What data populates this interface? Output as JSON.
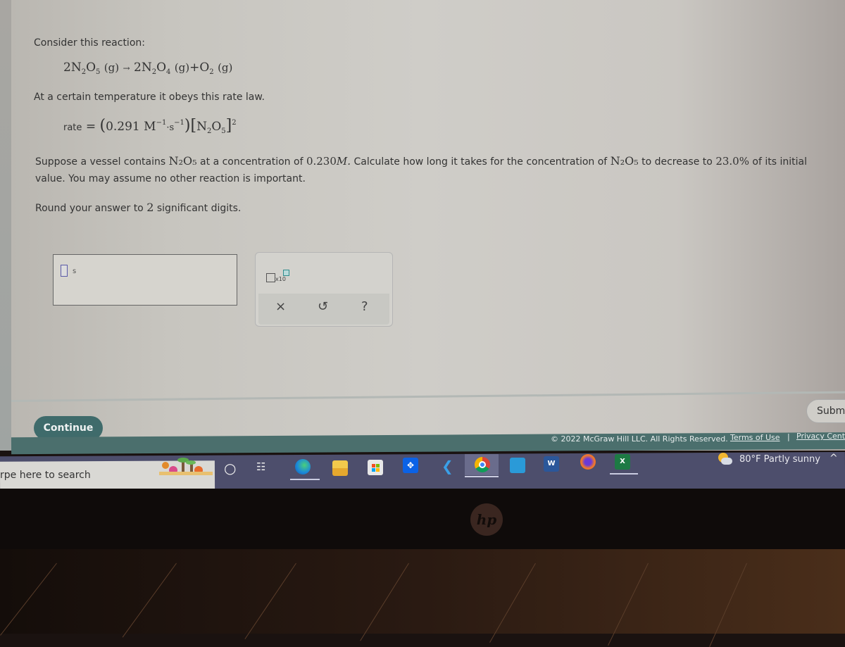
{
  "question": {
    "intro": "Consider this reaction:",
    "reaction": {
      "reactant": {
        "coef": "2",
        "formula": "N",
        "sub1": "2",
        "el2": "O",
        "sub2": "5",
        "state": "(g)"
      },
      "arrow": "→",
      "product1": {
        "coef": "2",
        "formula": "N",
        "sub1": "2",
        "el2": "O",
        "sub2": "4",
        "state": "(g)"
      },
      "plus": "+",
      "product2": {
        "formula": "O",
        "sub1": "2",
        "state": "(g)"
      }
    },
    "rate_law_intro": "At a certain temperature it obeys this rate law.",
    "rate_law": {
      "label": "rate",
      "equals": "=",
      "k_value": "0.291",
      "k_units": "M",
      "k_units_exp1": "−1",
      "k_units_dot": "·s",
      "k_units_exp2": "−1",
      "species": "N",
      "species_sub1": "2",
      "species_el2": "O",
      "species_sub2": "5",
      "order": "2"
    },
    "prompt_part1": "Suppose a vessel contains",
    "prompt_species": "N₂O₅",
    "prompt_part2": "at a concentration of",
    "concentration": "0.230",
    "concentration_unit": "M.",
    "prompt_part3": "Calculate how long it takes for the concentration of",
    "prompt_part4": "to decrease to",
    "percent": "23.0%",
    "prompt_part5": "of its initial",
    "prompt_line2": "value. You may assume no other reaction is important.",
    "round_part1": "Round your answer to",
    "sig_digits": "2",
    "round_part2": "significant digits."
  },
  "answer": {
    "value": "",
    "unit": "s"
  },
  "tools": {
    "sci_notation_label": "x10",
    "clear_symbol": "×",
    "undo_symbol": "↺",
    "help_symbol": "?"
  },
  "actions": {
    "continue_label": "Continue",
    "submit_label": "Subm"
  },
  "footer": {
    "copyright": "© 2022 McGraw Hill LLC. All Rights Reserved.",
    "terms": "Terms of Use",
    "separator": "|",
    "privacy": "Privacy Cente"
  },
  "taskbar": {
    "search_placeholder": "rpe here to search",
    "icons": [
      "search-highlight-icon",
      "cortana-icon",
      "task-view-icon",
      "edge-icon",
      "file-explorer-icon",
      "microsoft-store-icon",
      "dropbox-icon",
      "power-automate-icon",
      "chrome-icon",
      "mail-icon",
      "word-icon",
      "firefox-icon",
      "excel-icon"
    ],
    "weather_temp": "80°F",
    "weather_desc": "Partly sunny",
    "tray_chevron": "^"
  },
  "device": {
    "logo": "hp"
  }
}
